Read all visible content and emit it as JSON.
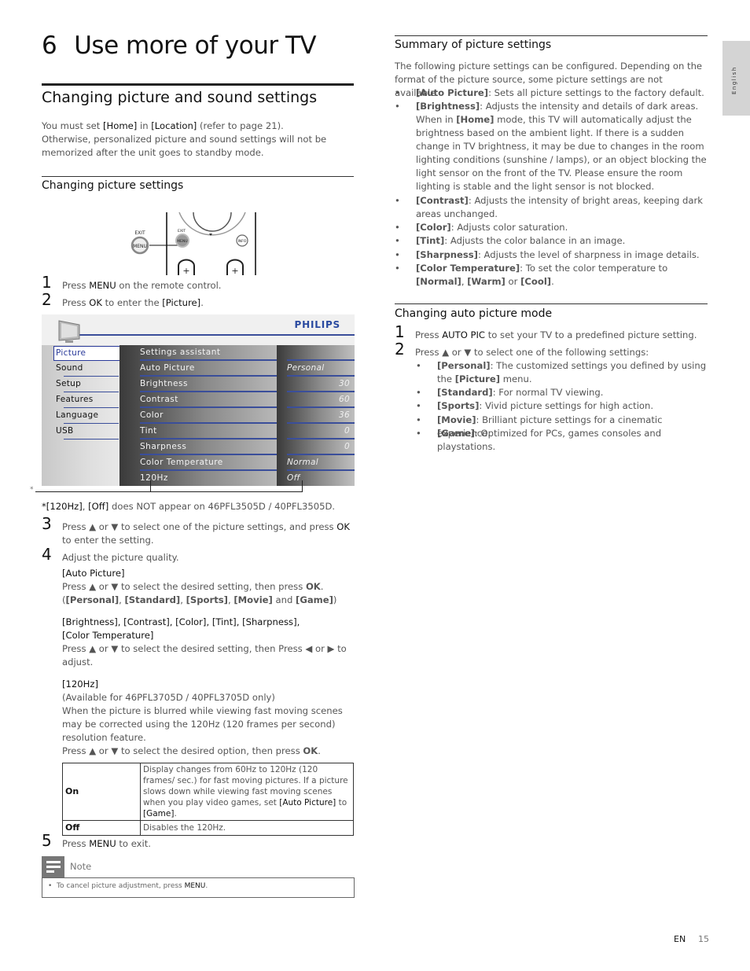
{
  "chapter": {
    "number": "6",
    "title": "Use more of your TV"
  },
  "section": {
    "title": "Changing picture and sound settings"
  },
  "intro": {
    "line1_pre": "You must set ",
    "home": "[Home]",
    "in": " in ",
    "location": "[Location]",
    "line1_post": " (refer to page 21).",
    "line2": "Otherwise, personalized picture and sound settings will not be memorized after the unit goes to standby mode."
  },
  "changing_picture": {
    "title": "Changing picture settings",
    "remote_labels": {
      "exit": "EXIT",
      "menu": "MENU",
      "info": "INFO"
    },
    "steps": [
      {
        "n": "1",
        "pre": "Press ",
        "key": "MENU",
        "post": " on the remote control."
      },
      {
        "n": "2",
        "pre": "Press ",
        "key": "OK",
        "post": " to enter the ",
        "key2": "[Picture]",
        "post2": "."
      }
    ]
  },
  "tv_menu": {
    "brand": "PHILIPS",
    "left_items": [
      "Picture",
      "Sound",
      "Setup",
      "Features",
      "Language",
      "USB"
    ],
    "selected_left": "Picture",
    "middle_items": [
      "Settings assistant",
      "Auto Picture",
      "Brightness",
      "Contrast",
      "Color",
      "Tint",
      "Sharpness",
      "Color Temperature",
      "120Hz"
    ],
    "right_values": [
      "",
      "Personal",
      "30",
      "60",
      "36",
      "0",
      "0",
      "Normal",
      "Off"
    ],
    "asterisk": "*"
  },
  "footnote": {
    "star": "*",
    "keys": "[120Hz]",
    "sep": ", ",
    "off": "[Off]",
    "text": " does NOT appear on 46PFL3505D / 40PFL3505D."
  },
  "step3": {
    "n": "3",
    "pre": "Press ▲ or ▼ to select one of the picture settings, and press ",
    "key": "OK",
    "post": " to enter the setting."
  },
  "step4": {
    "n": "4",
    "text": "Adjust the picture quality.",
    "auto_picture": {
      "heading": "[Auto Picture]",
      "line_pre": "Press ▲ or ▼ to select the desired setting, then press ",
      "key": "OK",
      "line_post": ".",
      "options_pre": "(",
      "options": [
        "[Personal]",
        "[Standard]",
        "[Sports]",
        "[Movie]",
        "[Game]"
      ],
      "and": " and ",
      "options_post": ")"
    },
    "adjust": {
      "heading1": "[Brightness], [Contrast], [Color], [Tint], [Sharpness],",
      "heading2": "[Color Temperature]",
      "text": "Press ▲ or ▼ to select the desired setting, then Press ◀ or ▶ to adjust."
    },
    "hz120": {
      "heading": "[120Hz]",
      "availability": "(Available for 46PFL3705D / 40PFL3705D only)",
      "text": "When the picture is blurred while viewing fast moving scenes may be corrected using the 120Hz (120 frames per second) resolution feature.",
      "press_pre": "Press ▲ or ▼ to select the desired option, then press ",
      "key": "OK",
      "press_post": ".",
      "table": [
        {
          "option": "On",
          "desc_pre": "Display changes from 60Hz to 120Hz (120 frames/ sec.) for fast moving pictures. If a picture slows down while viewing fast moving scenes when you play video games, set ",
          "k1": "[Auto Picture]",
          "mid": " to ",
          "k2": "[Game]",
          "desc_post": "."
        },
        {
          "option": "Off",
          "desc_pre": "Disables the 120Hz.",
          "k1": "",
          "mid": "",
          "k2": "",
          "desc_post": ""
        }
      ]
    }
  },
  "step5": {
    "n": "5",
    "pre": "Press ",
    "key": "MENU",
    "post": " to exit."
  },
  "note": {
    "label": "Note",
    "bullet": "•",
    "pre": "To cancel picture adjustment, press ",
    "key": "MENU",
    "post": "."
  },
  "summary": {
    "title": "Summary of picture settings",
    "intro": "The following picture settings can be configured. Depending on the format of the picture source, some picture settings are not available.",
    "items": [
      {
        "key": "[Auto Picture]",
        "text": ": Sets all picture settings to the factory default."
      },
      {
        "key": "[Brightness]",
        "text": ": Adjusts the intensity and details of dark areas.",
        "extra_pre": "When in ",
        "extra_key": "[Home]",
        "extra_post": " mode, this TV will automatically adjust the brightness based on the ambient light. If there is a sudden change in TV brightness, it may be due to changes in the room lighting conditions (sunshine / lamps), or an object blocking the light sensor on the front of the TV. Please ensure the room lighting is stable and the light sensor is not blocked."
      },
      {
        "key": "[Contrast]",
        "text": ": Adjusts the intensity of bright areas, keeping dark areas unchanged."
      },
      {
        "key": "[Color]",
        "text": ": Adjusts color saturation."
      },
      {
        "key": "[Tint]",
        "text": ": Adjusts the color balance in an image."
      },
      {
        "key": "[Sharpness]",
        "text": ": Adjusts the level of sharpness in image details."
      },
      {
        "key": "[Color Temperature]",
        "text": ": To set the color temperature to ",
        "k2": "[Normal]",
        "t2": ", ",
        "k3": "[Warm]",
        "t3": " or ",
        "k4": "[Cool]",
        "t4": "."
      }
    ]
  },
  "auto_pic_mode": {
    "title": "Changing auto picture mode",
    "step1": {
      "n": "1",
      "pre": "Press ",
      "key": "AUTO PIC",
      "post": " to set your TV to a predefined picture setting."
    },
    "step2": {
      "n": "2",
      "text": "Press ▲ or ▼ to select one of the following settings:"
    },
    "options": [
      {
        "key": "[Personal]",
        "text": ": The customized settings you defined by using the ",
        "k2": "[Picture]",
        "t2": " menu."
      },
      {
        "key": "[Standard]",
        "text": ": For normal TV viewing."
      },
      {
        "key": "[Sports]",
        "text": ": Vivid picture settings for high action."
      },
      {
        "key": "[Movie]",
        "text": ": Brilliant picture settings for a cinematic experience."
      },
      {
        "key": "[Game]",
        "text": ": Optimized for PCs, games consoles and playstations."
      }
    ]
  },
  "side_tab": {
    "language": "English"
  },
  "footer": {
    "lang": "EN",
    "page": "15"
  },
  "bullet": "•"
}
